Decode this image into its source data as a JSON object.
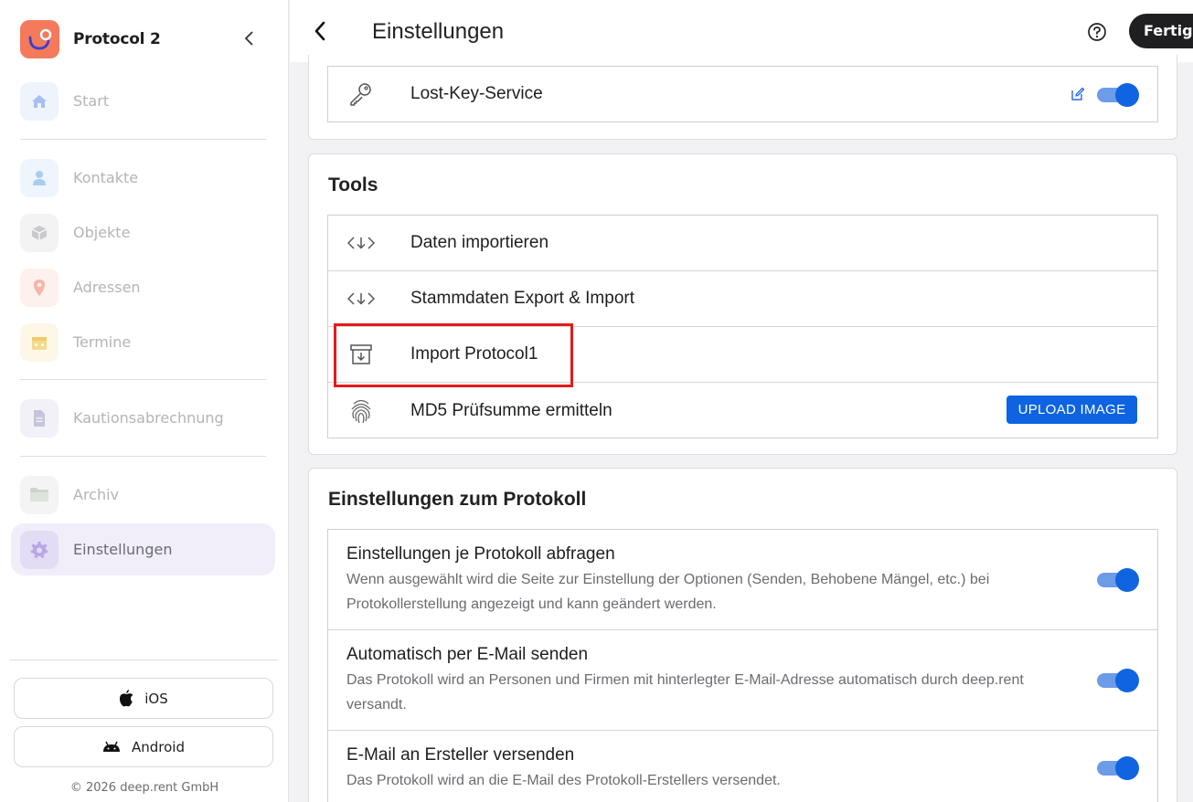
{
  "app": {
    "name": "Protocol 2"
  },
  "sidebar": {
    "items": [
      {
        "label": "Start",
        "icon": "home-icon"
      },
      {
        "label": "Kontakte",
        "icon": "person-icon"
      },
      {
        "label": "Objekte",
        "icon": "cube-icon"
      },
      {
        "label": "Adressen",
        "icon": "location-pin-icon"
      },
      {
        "label": "Termine",
        "icon": "calendar-icon"
      },
      {
        "label": "Kautionsabrechnung",
        "icon": "document-icon"
      },
      {
        "label": "Archiv",
        "icon": "folder-icon"
      },
      {
        "label": "Einstellungen",
        "icon": "gear-icon",
        "active": true
      }
    ],
    "store_buttons": {
      "ios": "iOS",
      "android": "Android"
    },
    "copyright": "© 2026 deep.rent GmbH"
  },
  "header": {
    "title": "Einstellungen",
    "done_label": "Fertig"
  },
  "top_card": {
    "row_label": "Lost-Key-Service",
    "toggle_on": true
  },
  "tools": {
    "title": "Tools",
    "rows": [
      {
        "label": "Daten importieren",
        "icon": "code-download-icon"
      },
      {
        "label": "Stammdaten Export & Import",
        "icon": "code-download-icon"
      },
      {
        "label": "Import Protocol1",
        "icon": "archive-download-icon"
      },
      {
        "label": "MD5 Prüfsumme ermitteln",
        "icon": "fingerprint-icon",
        "button": "UPLOAD IMAGE"
      }
    ]
  },
  "protocol_settings": {
    "title": "Einstellungen zum Protokoll",
    "rows": [
      {
        "title": "Einstellungen je Protokoll abfragen",
        "desc_1": "Wenn ausgewählt wird die Seite zur Einstellung der Optionen (Senden, Behobene Mängel, etc.) bei",
        "desc_2": "Protokollerstellung angezeigt und kann geändert werden.",
        "on": true
      },
      {
        "title": "Automatisch per E-Mail senden",
        "desc_1": "Das Protokoll wird an Personen und Firmen mit hinterlegter E-Mail-Adresse automatisch durch deep.rent",
        "desc_2": "versandt.",
        "on": true
      },
      {
        "title": "E-Mail an Ersteller versenden",
        "desc_1": "Das Protokoll wird an die E-Mail des Protokoll-Erstellers versendet.",
        "on": true
      }
    ]
  },
  "colors": {
    "accent": "#1064e0",
    "brand": "#f47a5c",
    "highlight": "#e31b1b"
  }
}
